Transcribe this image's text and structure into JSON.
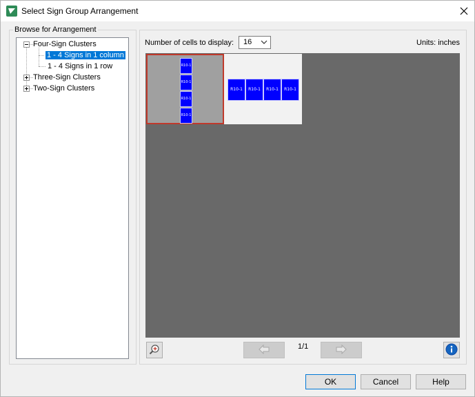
{
  "window": {
    "title": "Select Sign Group Arrangement"
  },
  "browse": {
    "group_label": "Browse for Arrangement",
    "tree": [
      {
        "label": "Four-Sign Clusters",
        "expanded": true,
        "children": [
          {
            "label": "1 - 4 Signs in 1 column",
            "selected": true
          },
          {
            "label": "1 - 4 Signs in 1 row",
            "selected": false
          }
        ]
      },
      {
        "label": "Three-Sign Clusters",
        "expanded": false
      },
      {
        "label": "Two-Sign Clusters",
        "expanded": false
      }
    ]
  },
  "display": {
    "cells_label": "Number of cells to display:",
    "cells_value": "16",
    "units_label": "Units: inches"
  },
  "gallery": {
    "sign_code": "R10-1",
    "cells": [
      {
        "arrangement": "column",
        "selected": true,
        "sign_count": 4
      },
      {
        "arrangement": "row",
        "selected": false,
        "sign_count": 4
      }
    ]
  },
  "pager": {
    "page": "1/1"
  },
  "buttons": {
    "ok": "OK",
    "cancel": "Cancel",
    "help": "Help"
  },
  "colors": {
    "sign_fill": "#0000ff",
    "gallery_background": "#696969",
    "selection_border": "#c0392b",
    "tree_selection": "#0078d7"
  }
}
